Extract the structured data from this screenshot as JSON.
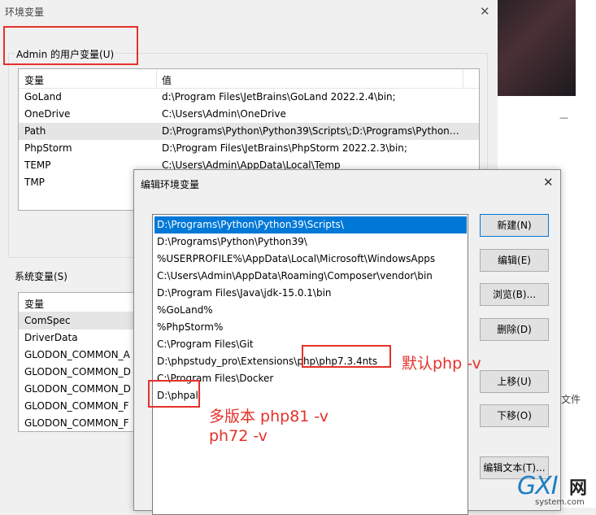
{
  "env_window": {
    "title": "环境变量",
    "user_group_label": "Admin 的用户变量(U)",
    "user_table": {
      "headers": [
        "变量",
        "值"
      ],
      "rows": [
        {
          "name": "GoLand",
          "value": "d:\\Program Files\\JetBrains\\GoLand 2022.2.4\\bin;"
        },
        {
          "name": "OneDrive",
          "value": "C:\\Users\\Admin\\OneDrive"
        },
        {
          "name": "Path",
          "value": "D:\\Programs\\Python\\Python39\\Scripts\\;D:\\Programs\\Python\\..."
        },
        {
          "name": "PhpStorm",
          "value": "D:\\Program Files\\JetBrains\\PhpStorm 2022.2.3\\bin;"
        },
        {
          "name": "TEMP",
          "value": "C:\\Users\\Admin\\AppData\\Local\\Temp"
        },
        {
          "name": "TMP",
          "value": ""
        }
      ],
      "selected_index": 2
    },
    "system_group_label": "系统变量(S)",
    "system_table": {
      "headers": [
        "变量"
      ],
      "rows": [
        "ComSpec",
        "DriverData",
        "GLODON_COMMON_A",
        "GLODON_COMMON_D",
        "GLODON_COMMON_D",
        "GLODON_COMMON_F",
        "GLODON_COMMON_F"
      ],
      "selected_index": 0
    }
  },
  "right_panel": {
    "dash": "—",
    "file_text": "文件"
  },
  "edit_dialog": {
    "title": "编辑环境变量",
    "paths": [
      "D:\\Programs\\Python\\Python39\\Scripts\\",
      "D:\\Programs\\Python\\Python39\\",
      "%USERPROFILE%\\AppData\\Local\\Microsoft\\WindowsApps",
      "C:\\Users\\Admin\\AppData\\Roaming\\Composer\\vendor\\bin",
      "D:\\Program Files\\Java\\jdk-15.0.1\\bin",
      "%GoLand%",
      "%PhpStorm%",
      "C:\\Program Files\\Git",
      "D:\\phpstudy_pro\\Extensions\\php\\php7.3.4nts",
      "C:\\Program Files\\Docker",
      "D:\\phpall"
    ],
    "selected_index": 0,
    "buttons": {
      "new": "新建(N)",
      "edit": "编辑(E)",
      "browse": "浏览(B)...",
      "delete": "删除(D)",
      "move_up": "上移(U)",
      "move_down": "下移(O)",
      "edit_text": "编辑文本(T)..."
    }
  },
  "annotations": {
    "default_php": "默认php -v",
    "multi_version_line1": "多版本 php81 -v",
    "multi_version_line2": "ph72 -v"
  },
  "watermark": {
    "main": "GXI",
    "cn": "网",
    "sub": "system.com"
  },
  "colors": {
    "annotation_red": "#e5312a",
    "selection_blue": "#0078d7",
    "watermark_blue": "#1b7fc4"
  }
}
